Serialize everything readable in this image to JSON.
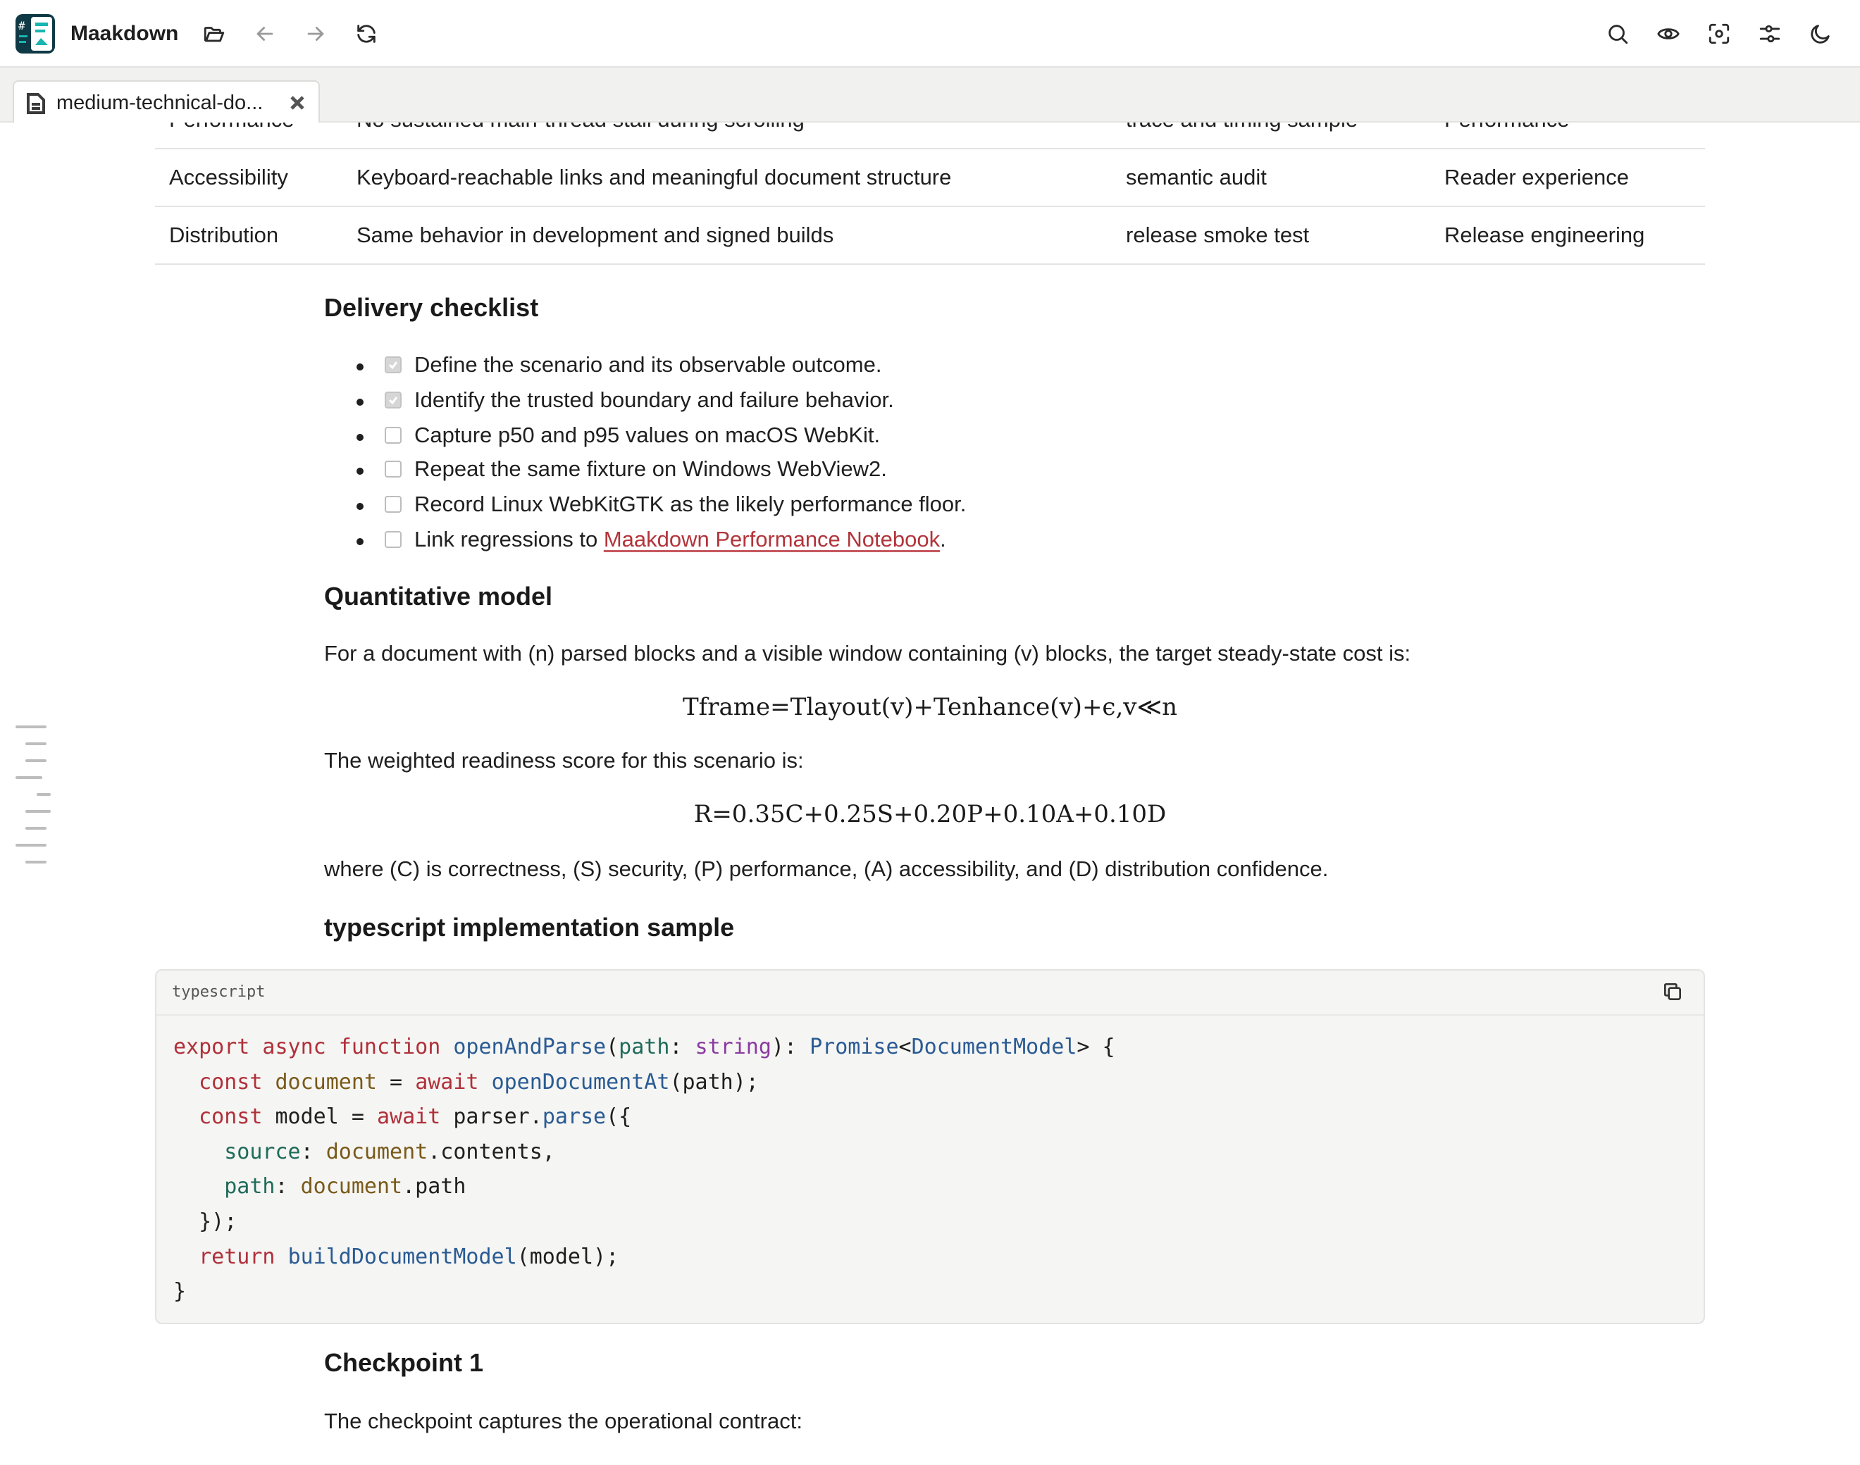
{
  "app": {
    "name": "Maakdown"
  },
  "tab": {
    "label": "medium-technical-do..."
  },
  "table": {
    "rows": [
      [
        "Performance",
        "No sustained main-thread stall during scrolling",
        "trace and timing sample",
        "Performance"
      ],
      [
        "Accessibility",
        "Keyboard-reachable links and meaningful document structure",
        "semantic audit",
        "Reader experience"
      ],
      [
        "Distribution",
        "Same behavior in development and signed builds",
        "release smoke test",
        "Release engineering"
      ]
    ]
  },
  "checklist": {
    "title": "Delivery checklist",
    "items": [
      {
        "text": "Define the scenario and its observable outcome.",
        "checked": true
      },
      {
        "text": "Identify the trusted boundary and failure behavior.",
        "checked": true
      },
      {
        "text": "Capture p50 and p95 values on macOS WebKit.",
        "checked": false
      },
      {
        "text": "Repeat the same fixture on Windows WebView2.",
        "checked": false
      },
      {
        "text": "Record Linux WebKitGTK as the likely performance floor.",
        "checked": false
      }
    ],
    "link_item": {
      "prefix": "Link regressions to ",
      "link": "Maakdown Performance Notebook",
      "suffix": "."
    }
  },
  "quant": {
    "title": "Quantitative model",
    "intro": "For a document with (n) parsed blocks and a visible window containing (v) blocks, the target steady-state cost is:",
    "formula1": "Tframe=Tlayout(v)+Tenhance(v)+ϵ,v≪n",
    "score_intro": "The weighted readiness score for this scenario is:",
    "formula2": "R=0.35C+0.25S+0.20P+0.10A+0.10D",
    "where": "where (C) is correctness, (S) security, (P) performance, (A) accessibility, and (D) distribution confidence."
  },
  "code": {
    "title": "typescript implementation sample",
    "language": "typescript"
  },
  "checkpoint": {
    "title": "Checkpoint 1",
    "text": "The checkpoint captures the operational contract:"
  },
  "colors": {
    "accent_link": "#b2343a",
    "code_bg": "#f5f5f3"
  }
}
